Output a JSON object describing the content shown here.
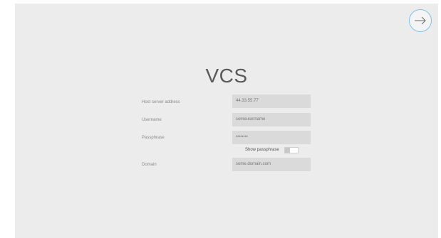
{
  "app": {
    "title": "VCS"
  },
  "form": {
    "host": {
      "label": "Host server address",
      "value": "44.33.55.77"
    },
    "username": {
      "label": "Username",
      "value": "someusername"
    },
    "passphrase": {
      "label": "Passphrase",
      "value": "••••••••"
    },
    "show_passphrase": {
      "label": "Show passphrase",
      "checked": false
    },
    "domain": {
      "label": "Domain",
      "value": "some.domain.com"
    }
  },
  "icons": {
    "next": "arrow-right-icon"
  },
  "colors": {
    "accent": "#7ec3e8",
    "background": "#ececec",
    "input_fill": "#dadada"
  }
}
